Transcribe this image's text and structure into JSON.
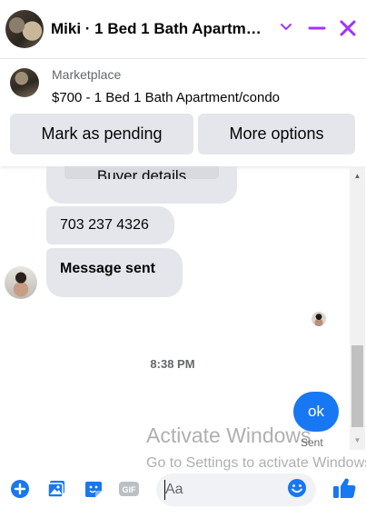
{
  "header": {
    "title": "Miki · 1 Bed 1 Bath Apartm…",
    "icons": {
      "options": "chevron-down-icon",
      "minimize": "minimize-icon",
      "close": "close-icon"
    },
    "accent_color": "#a033ff"
  },
  "listing": {
    "source": "Marketplace",
    "title": "$700 - 1 Bed 1 Bath Apartment/condo",
    "buttons": {
      "mark_pending": "Mark as pending",
      "more_options": "More options"
    }
  },
  "messages": [
    {
      "sender": "other",
      "text": "Buyer details"
    },
    {
      "sender": "other",
      "text": "703 237 4326"
    },
    {
      "sender": "other",
      "text": "Message sent"
    },
    {
      "sender": "me",
      "text": "ok",
      "status": "Sent"
    }
  ],
  "timestamp": "8:38 PM",
  "watermark": {
    "title": "Activate Windows",
    "subtitle": "Go to Settings to activate Windows."
  },
  "composer": {
    "placeholder": "Aa",
    "icons": [
      "plus-circle-icon",
      "photo-icon",
      "sticker-icon",
      "gif-icon",
      "emoji-icon",
      "thumbs-up-icon"
    ],
    "gif_label": "GIF"
  },
  "colors": {
    "messenger_blue": "#1877f2",
    "bubble_gray": "#e4e6eb",
    "secondary_text": "#65676b"
  }
}
